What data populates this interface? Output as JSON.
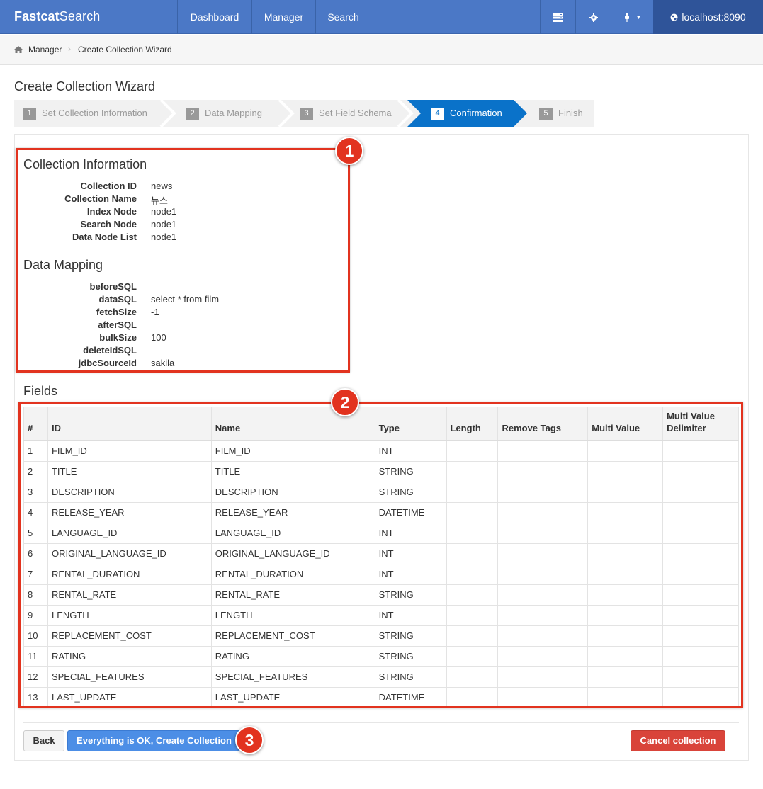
{
  "nav": {
    "brand_bold": "Fastcat",
    "brand_rest": "Search",
    "items": [
      {
        "label": "Dashboard"
      },
      {
        "label": "Manager"
      },
      {
        "label": "Search"
      }
    ],
    "icons": [
      "server-icon",
      "gear-icon",
      "user-icon"
    ],
    "host": "localhost:8090"
  },
  "breadcrumb": {
    "items": [
      "Manager",
      "Create Collection Wizard"
    ]
  },
  "page": {
    "title": "Create Collection Wizard"
  },
  "wizard": {
    "steps": [
      {
        "num": "1",
        "label": "Set Collection Information",
        "active": false
      },
      {
        "num": "2",
        "label": "Data Mapping",
        "active": false
      },
      {
        "num": "3",
        "label": "Set Field Schema",
        "active": false
      },
      {
        "num": "4",
        "label": "Confirmation",
        "active": true
      },
      {
        "num": "5",
        "label": "Finish",
        "active": false
      }
    ]
  },
  "collection_info": {
    "title": "Collection Information",
    "rows": [
      {
        "key": "Collection ID",
        "value": "news"
      },
      {
        "key": "Collection Name",
        "value": "뉴스"
      },
      {
        "key": "Index Node",
        "value": "node1"
      },
      {
        "key": "Search Node",
        "value": "node1"
      },
      {
        "key": "Data Node List",
        "value": "node1"
      }
    ]
  },
  "data_mapping": {
    "title": "Data Mapping",
    "rows": [
      {
        "key": "beforeSQL",
        "value": ""
      },
      {
        "key": "dataSQL",
        "value": "select * from film"
      },
      {
        "key": "fetchSize",
        "value": "-1"
      },
      {
        "key": "afterSQL",
        "value": ""
      },
      {
        "key": "bulkSize",
        "value": "100"
      },
      {
        "key": "deleteIdSQL",
        "value": ""
      },
      {
        "key": "jdbcSourceId",
        "value": "sakila"
      }
    ]
  },
  "fields": {
    "title": "Fields",
    "columns": [
      "#",
      "ID",
      "Name",
      "Type",
      "Length",
      "Remove Tags",
      "Multi Value",
      "Multi Value Delimiter"
    ],
    "rows": [
      [
        "1",
        "FILM_ID",
        "FILM_ID",
        "INT",
        "",
        "",
        "",
        ""
      ],
      [
        "2",
        "TITLE",
        "TITLE",
        "STRING",
        "",
        "",
        "",
        ""
      ],
      [
        "3",
        "DESCRIPTION",
        "DESCRIPTION",
        "STRING",
        "",
        "",
        "",
        ""
      ],
      [
        "4",
        "RELEASE_YEAR",
        "RELEASE_YEAR",
        "DATETIME",
        "",
        "",
        "",
        ""
      ],
      [
        "5",
        "LANGUAGE_ID",
        "LANGUAGE_ID",
        "INT",
        "",
        "",
        "",
        ""
      ],
      [
        "6",
        "ORIGINAL_LANGUAGE_ID",
        "ORIGINAL_LANGUAGE_ID",
        "INT",
        "",
        "",
        "",
        ""
      ],
      [
        "7",
        "RENTAL_DURATION",
        "RENTAL_DURATION",
        "INT",
        "",
        "",
        "",
        ""
      ],
      [
        "8",
        "RENTAL_RATE",
        "RENTAL_RATE",
        "STRING",
        "",
        "",
        "",
        ""
      ],
      [
        "9",
        "LENGTH",
        "LENGTH",
        "INT",
        "",
        "",
        "",
        ""
      ],
      [
        "10",
        "REPLACEMENT_COST",
        "REPLACEMENT_COST",
        "STRING",
        "",
        "",
        "",
        ""
      ],
      [
        "11",
        "RATING",
        "RATING",
        "STRING",
        "",
        "",
        "",
        ""
      ],
      [
        "12",
        "SPECIAL_FEATURES",
        "SPECIAL_FEATURES",
        "STRING",
        "",
        "",
        "",
        ""
      ],
      [
        "13",
        "LAST_UPDATE",
        "LAST_UPDATE",
        "DATETIME",
        "",
        "",
        "",
        ""
      ]
    ]
  },
  "buttons": {
    "back": "Back",
    "ok": "Everything is OK, Create Collection",
    "cancel": "Cancel collection"
  },
  "markers": [
    "1",
    "2",
    "3"
  ],
  "colors": {
    "navbar": "#4b78c6",
    "wizard_active": "#0a72c9",
    "annotation_red": "#e2331f",
    "primary_button": "#4c8ee6",
    "danger_button": "#d9443a"
  }
}
